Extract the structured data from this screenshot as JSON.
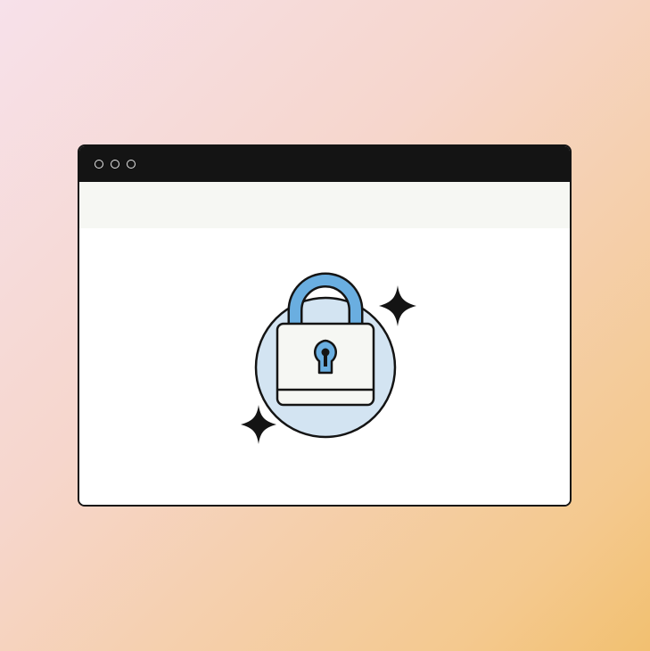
{
  "window": {
    "titlebar_buttons": [
      "window-control",
      "window-control",
      "window-control"
    ]
  },
  "illustration": {
    "icon": "padlock-icon",
    "decorations": [
      "sparkle-icon",
      "sparkle-icon"
    ]
  },
  "colors": {
    "background_start": "#f7e1ea",
    "background_end": "#f2c070",
    "frame": "#141414",
    "addressbar": "#f6f7f3",
    "circle_fill": "#d3e4f2",
    "shackle": "#6aaee0",
    "keyhole": "#6aaee0",
    "lock_body": "#f6f7f3"
  }
}
